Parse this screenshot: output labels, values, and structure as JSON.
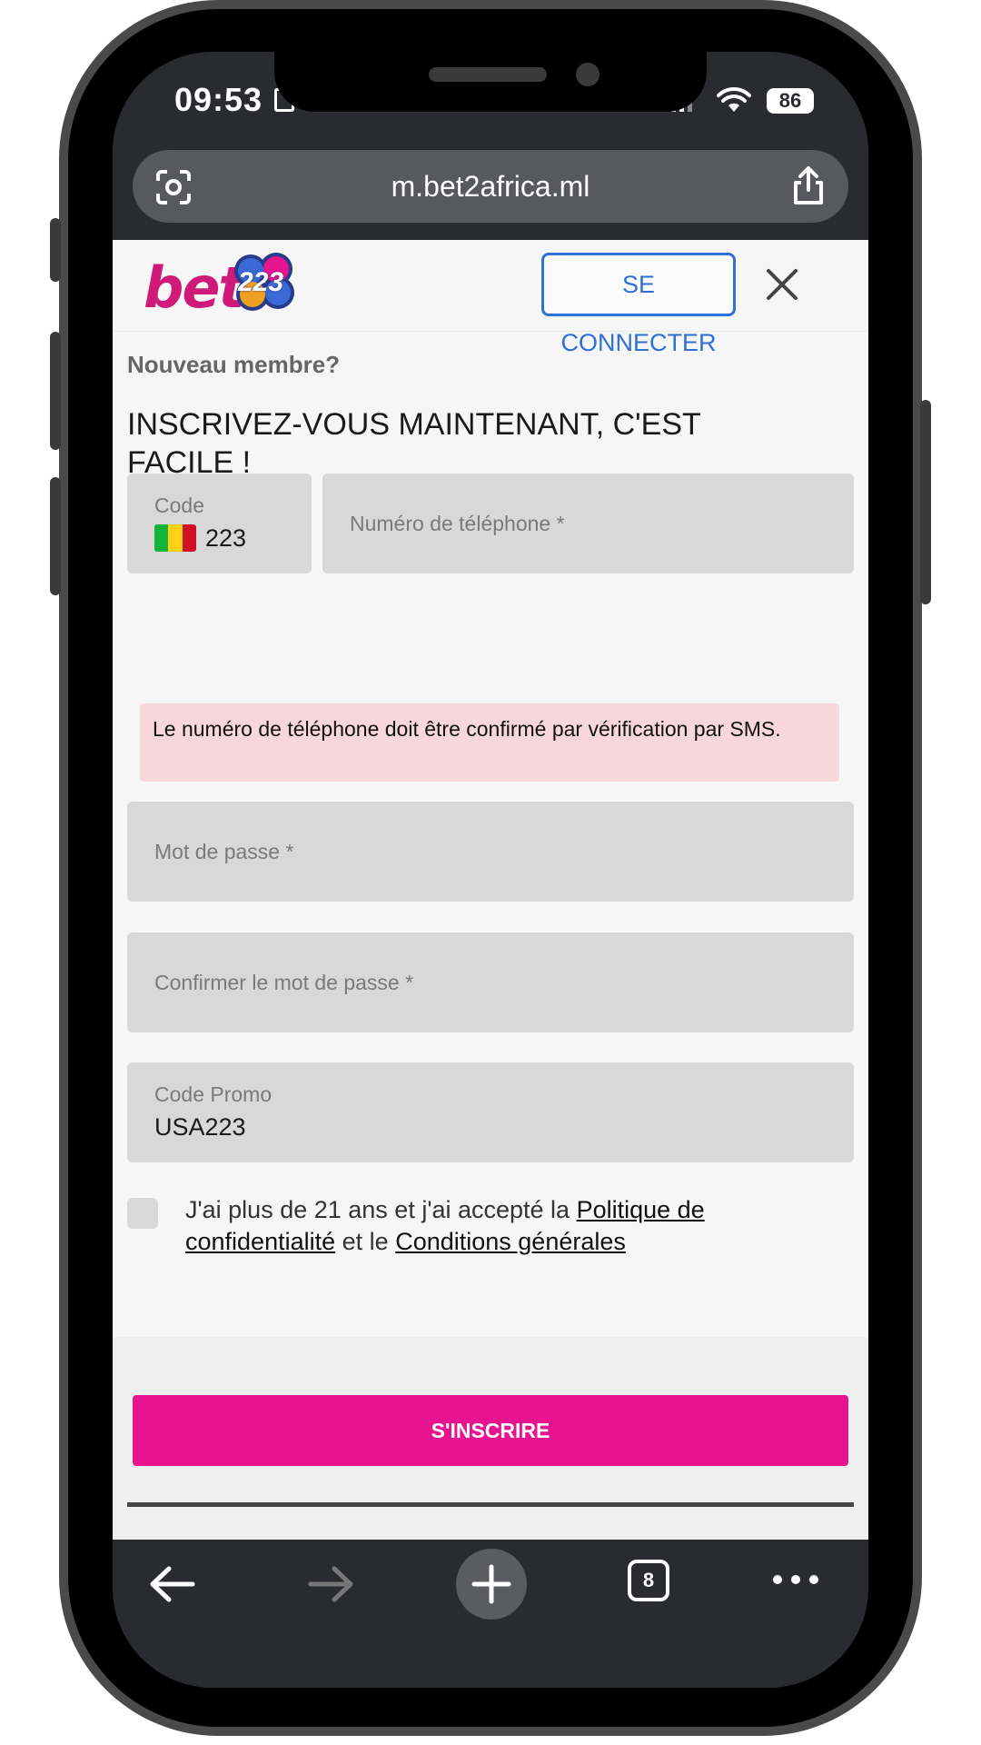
{
  "status_bar": {
    "time": "09:53",
    "battery": "86"
  },
  "browser": {
    "url": "m.bet2africa.ml",
    "tabs_count": "8"
  },
  "site": {
    "logo_text": "bet",
    "logo_number": "223",
    "connect_label": "SE CONNECTER"
  },
  "form": {
    "subtitle": "Nouveau membre?",
    "headline": "INSCRIVEZ-VOUS MAINTENANT, C'EST FACILE !",
    "code_label": "Code",
    "code_value": "223",
    "phone_placeholder": "Numéro de téléphone *",
    "sms_notice": "Le numéro de téléphone doit être confirmé par vérification par SMS.",
    "password_placeholder": "Mot de passe *",
    "confirm_password_placeholder": "Confirmer le mot de passe *",
    "promo_label": "Code Promo",
    "promo_value": "USA223",
    "terms_prefix": "J'ai plus de 21 ans et j'ai accepté la",
    "privacy_link": "Politique de confidentialité",
    "terms_middle": "et le",
    "conditions_link": "Conditions générales",
    "submit_label": "S'INSCRIRE"
  },
  "colors": {
    "brand_pink": "#e8148f",
    "connect_blue": "#2f6fd6",
    "alert_bg": "#f8d7dc",
    "mali_flag": [
      "#14b53a",
      "#fcd116",
      "#ce1126"
    ]
  }
}
